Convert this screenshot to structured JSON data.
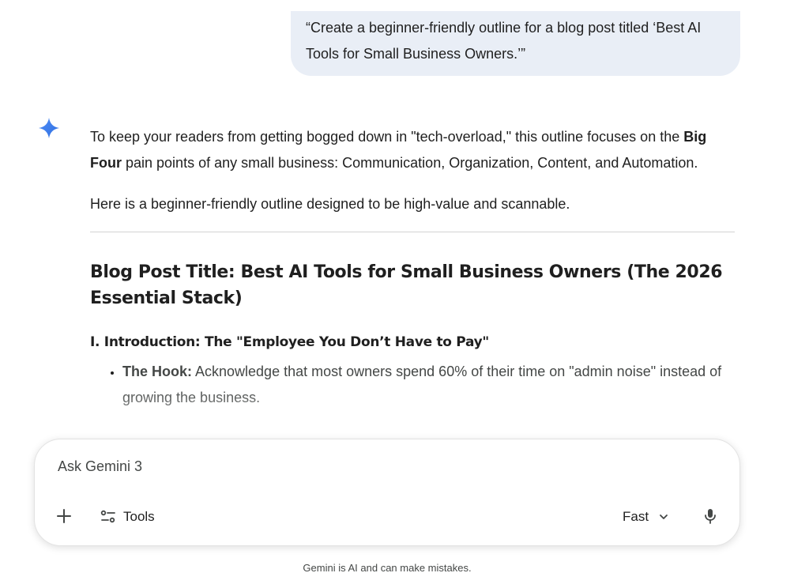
{
  "user_message": {
    "text": "“Create a beginner-friendly outline for a blog post titled ‘Best AI Tools for Small Business Owners.’”"
  },
  "response": {
    "intro_part1": "To keep your readers from getting bogged down in \"tech-overload,\" this outline focuses on the ",
    "intro_bold": "Big Four",
    "intro_part2": " pain points of any small business: Communication, Organization, Content, and Automation.",
    "line2": "Here is a beginner-friendly outline designed to be high-value and scannable.",
    "heading": "Blog Post Title: Best AI Tools for Small Business Owners (The 2026 Essential Stack)",
    "section_heading": "I. Introduction: The \"Employee You Don’t Have to Pay\"",
    "bullets": [
      {
        "label": "The Hook:",
        "text": " Acknowledge that most owners spend 60% of their time on \"admin noise\" instead of growing the business."
      }
    ]
  },
  "composer": {
    "placeholder": "Ask Gemini 3",
    "tools_label": "Tools",
    "mode_label": "Fast"
  },
  "footer": {
    "disclaimer": "Gemini is AI and can make mistakes."
  },
  "icons": {
    "assistant": "gemini-sparkle-icon",
    "add": "plus-icon",
    "tools": "tools-sliders-icon",
    "mode": "chevron-down-icon",
    "voice": "microphone-icon"
  },
  "colors": {
    "user_bubble": "#e9eef6",
    "sparkle": "#3b82f6",
    "text": "#1f1f1f",
    "muted": "#444746"
  }
}
